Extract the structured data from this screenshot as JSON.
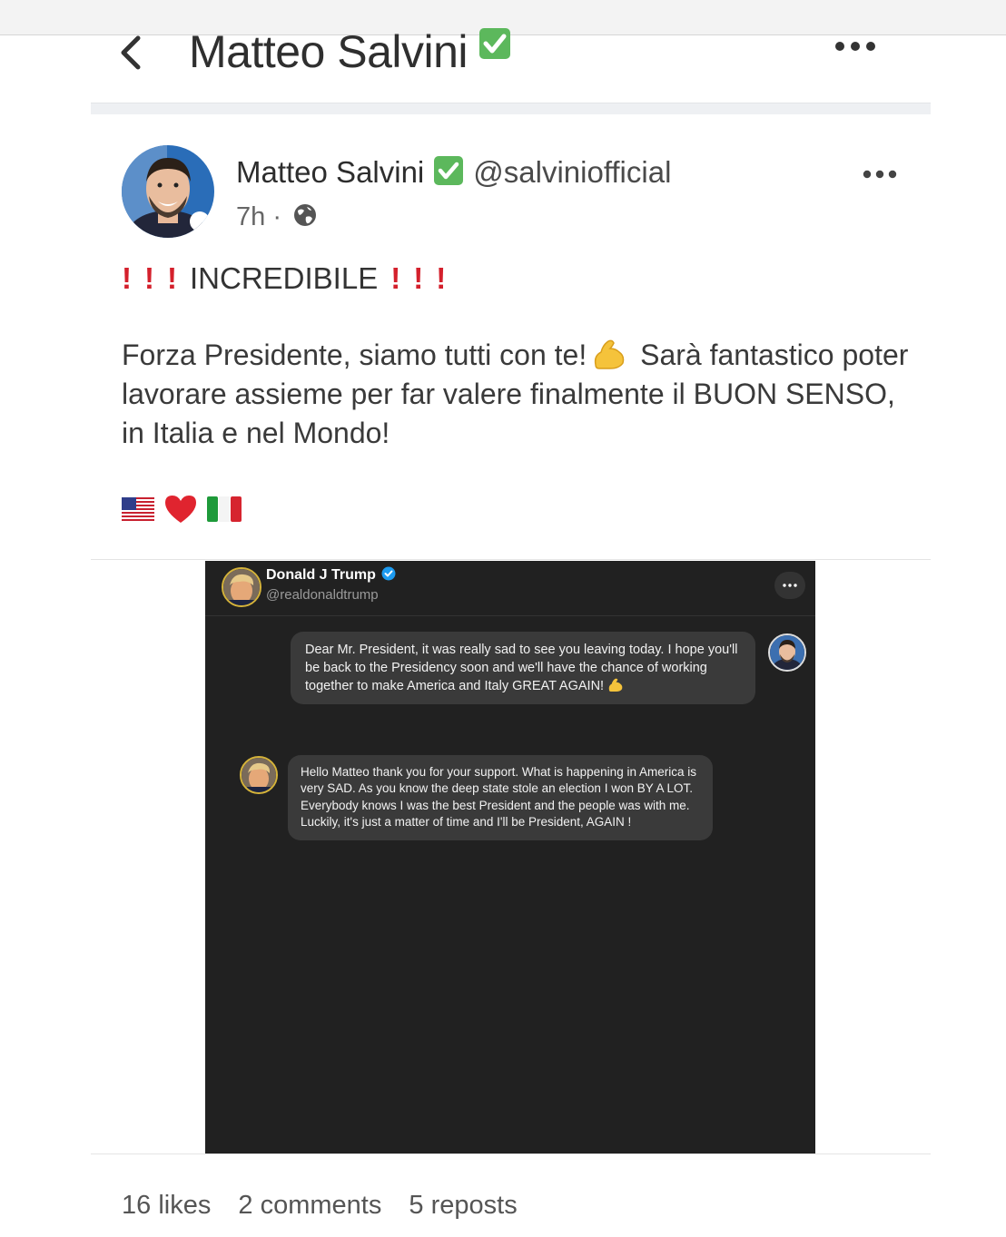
{
  "header": {
    "title": "Matteo Salvini"
  },
  "post": {
    "author_name": "Matteo Salvini",
    "handle": "@salviniofficial",
    "time": "7h",
    "time_sep": "·",
    "headline": "INCREDIBILE",
    "body_line1": "Forza Presidente, siamo tutti con te!",
    "body_rest": "Sarà fantastico poter lavorare assieme per far valere finalmente il BUON SENSO, in Italia e nel Mondo!",
    "emoji_row": [
      "us-flag-icon",
      "red-heart-icon",
      "italy-flag-icon"
    ]
  },
  "embedded": {
    "name": "Donald J Trump",
    "handle": "@realdonaldtrump",
    "messages": [
      {
        "from": "Salvini",
        "text": "Dear Mr. President, it was really sad to see you leaving today. I hope you'll be back to the Presidency soon and we'll have the chance of working together to make America and Italy GREAT AGAIN!"
      },
      {
        "from": "Trump",
        "text": "Hello Matteo thank you for your support. What is happening in America is very SAD. As you know the deep state stole an election I won BY A LOT. Everybody knows I was the best President and the people was with me. Luckily, it's just a matter of time and I'll be President, AGAIN !"
      }
    ]
  },
  "stats": {
    "likes": "16 likes",
    "comments": "2 comments",
    "reposts": "5 reposts"
  },
  "colors": {
    "verified_green": "#5cb85c",
    "alert_red": "#d4202c",
    "dark_panel": "#212121",
    "bubble": "#3a3a3a",
    "twitter_blue": "#1d9bf0"
  }
}
